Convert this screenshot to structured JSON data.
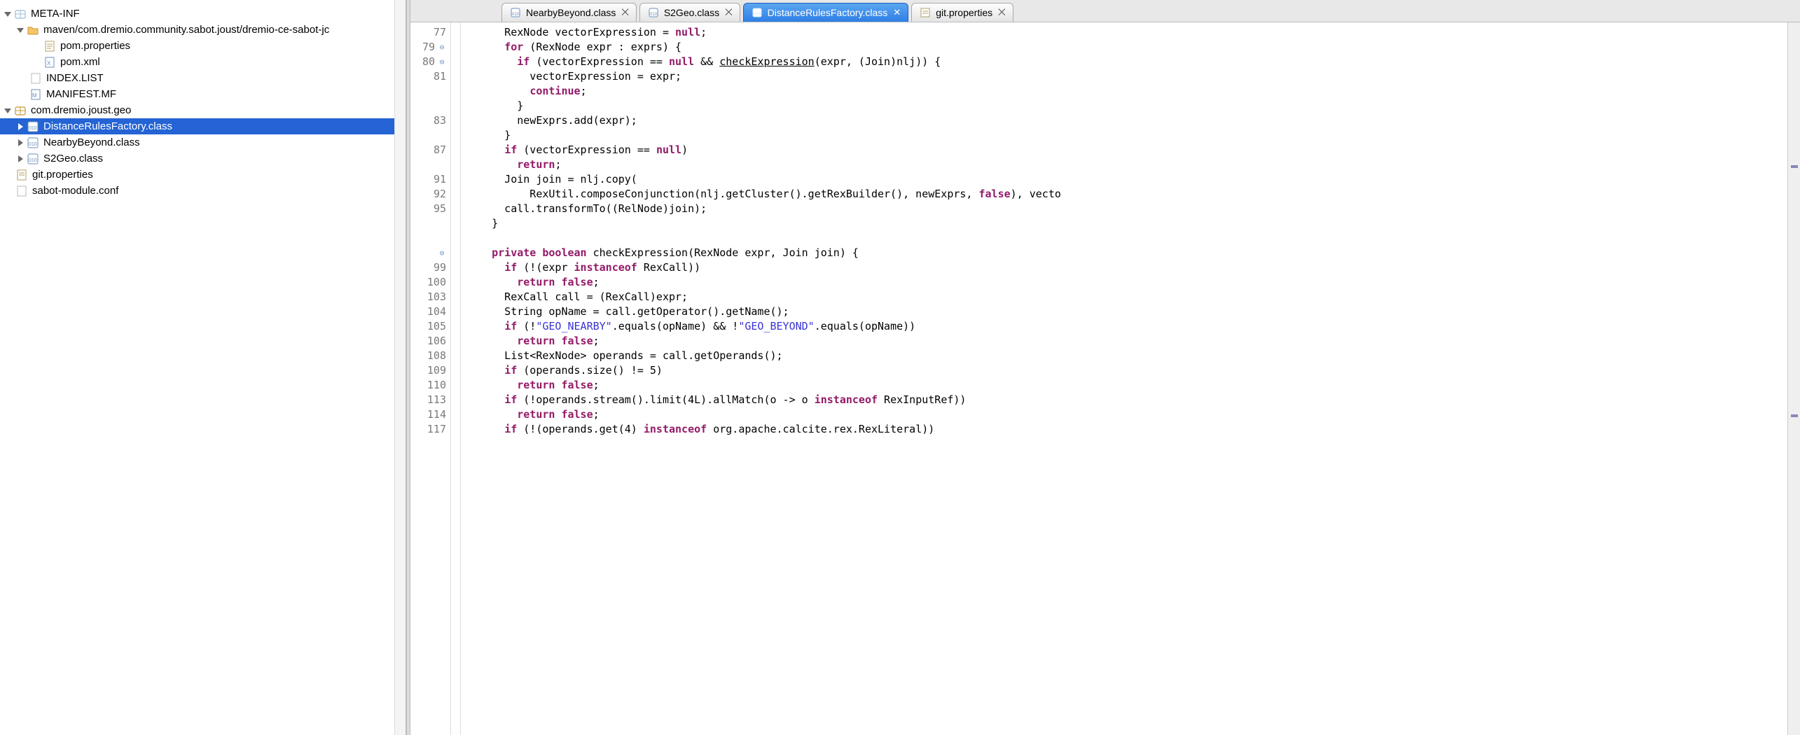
{
  "tree": {
    "meta_inf": "META-INF",
    "maven_path": "maven/com.dremio.community.sabot.joust/dremio-ce-sabot-jc",
    "pom_properties": "pom.properties",
    "pom_xml": "pom.xml",
    "index_list": "INDEX.LIST",
    "manifest_mf": "MANIFEST.MF",
    "pkg_geo": "com.dremio.joust.geo",
    "distance_rules": "DistanceRulesFactory.class",
    "nearby_beyond": "NearbyBeyond.class",
    "s2geo": "S2Geo.class",
    "git_properties": "git.properties",
    "sabot_module": "sabot-module.conf"
  },
  "tabs": [
    {
      "label": "NearbyBeyond.class",
      "icon": "class",
      "active": false
    },
    {
      "label": "S2Geo.class",
      "icon": "class",
      "active": false
    },
    {
      "label": "DistanceRulesFactory.class",
      "icon": "class",
      "active": true
    },
    {
      "label": "git.properties",
      "icon": "text",
      "active": false
    }
  ],
  "gutter": {
    "lines": [
      {
        "n": "77",
        "fold": ""
      },
      {
        "n": "79",
        "fold": "⊖"
      },
      {
        "n": "80",
        "fold": "⊖"
      },
      {
        "n": "81",
        "fold": ""
      },
      {
        "n": "",
        "fold": ""
      },
      {
        "n": "",
        "fold": ""
      },
      {
        "n": "83",
        "fold": ""
      },
      {
        "n": "",
        "fold": ""
      },
      {
        "n": "87",
        "fold": ""
      },
      {
        "n": "",
        "fold": ""
      },
      {
        "n": "91",
        "fold": ""
      },
      {
        "n": "92",
        "fold": ""
      },
      {
        "n": "95",
        "fold": ""
      },
      {
        "n": "",
        "fold": ""
      },
      {
        "n": "",
        "fold": ""
      },
      {
        "n": "",
        "fold": "⊖"
      },
      {
        "n": "99",
        "fold": ""
      },
      {
        "n": "100",
        "fold": ""
      },
      {
        "n": "103",
        "fold": ""
      },
      {
        "n": "104",
        "fold": ""
      },
      {
        "n": "105",
        "fold": ""
      },
      {
        "n": "106",
        "fold": ""
      },
      {
        "n": "108",
        "fold": ""
      },
      {
        "n": "109",
        "fold": ""
      },
      {
        "n": "110",
        "fold": ""
      },
      {
        "n": "113",
        "fold": ""
      },
      {
        "n": "114",
        "fold": ""
      },
      {
        "n": "117",
        "fold": ""
      }
    ]
  },
  "code": {
    "l01a": "      RexNode vectorExpression = ",
    "l01b": "null",
    "l01c": ";",
    "l02a": "      ",
    "l02b": "for",
    "l02c": " (RexNode expr : exprs) {",
    "l03a": "        ",
    "l03b": "if",
    "l03c": " (vectorExpression == ",
    "l03d": "null",
    "l03e": " && ",
    "l03f": "checkExpression",
    "l03g": "(expr, (Join)nlj)) {",
    "l04": "          vectorExpression = expr;",
    "l05a": "          ",
    "l05b": "continue",
    "l05c": ";",
    "l06": "        }",
    "l07": "        newExprs.add(expr);",
    "l08": "      }",
    "l09a": "      ",
    "l09b": "if",
    "l09c": " (vectorExpression == ",
    "l09d": "null",
    "l09e": ")",
    "l10a": "        ",
    "l10b": "return",
    "l10c": ";",
    "l11": "      Join join = nlj.copy(",
    "l12a": "          RexUtil.composeConjunction(nlj.getCluster().getRexBuilder(), newExprs, ",
    "l12b": "false",
    "l12c": "), vecto",
    "l13": "      call.transformTo((RelNode)join);",
    "l14": "    }",
    "l15": "",
    "l16a": "    ",
    "l16b": "private boolean",
    "l16c": " checkExpression(RexNode expr, Join join) {",
    "l17a": "      ",
    "l17b": "if",
    "l17c": " (!(expr ",
    "l17d": "instanceof",
    "l17e": " RexCall))",
    "l18a": "        ",
    "l18b": "return false",
    "l18c": ";",
    "l19": "      RexCall call = (RexCall)expr;",
    "l20": "      String opName = call.getOperator().getName();",
    "l21a": "      ",
    "l21b": "if",
    "l21c": " (!",
    "l21d": "\"GEO_NEARBY\"",
    "l21e": ".equals(opName) && !",
    "l21f": "\"GEO_BEYOND\"",
    "l21g": ".equals(opName))",
    "l22a": "        ",
    "l22b": "return false",
    "l22c": ";",
    "l23": "      List<RexNode> operands = call.getOperands();",
    "l24a": "      ",
    "l24b": "if",
    "l24c": " (operands.size() != 5)",
    "l25a": "        ",
    "l25b": "return false",
    "l25c": ";",
    "l26a": "      ",
    "l26b": "if",
    "l26c": " (!operands.stream().limit(4L).allMatch(o -> o ",
    "l26d": "instanceof",
    "l26e": " RexInputRef))",
    "l27a": "        ",
    "l27b": "return false",
    "l27c": ";",
    "l28a": "      ",
    "l28b": "if",
    "l28c": " (!(operands.get(4) ",
    "l28d": "instanceof",
    "l28e": " org.apache.calcite.rex.RexLiteral))"
  },
  "close_glyph": "⨉"
}
